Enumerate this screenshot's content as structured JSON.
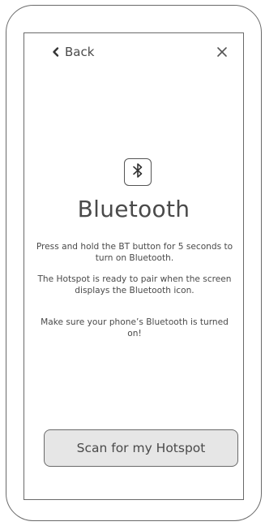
{
  "nav": {
    "back_label": "Back"
  },
  "content": {
    "title": "Bluetooth",
    "instruction_1": "Press and hold the BT button for 5 seconds to turn on Bluetooth.",
    "instruction_2": "The Hotspot is ready to pair when the screen displays the Bluetooth icon.",
    "instruction_3": "Make sure your phone’s Bluetooth is turned on!"
  },
  "actions": {
    "scan_label": "Scan for my Hotspot"
  },
  "icons": {
    "back": "chevron-left-icon",
    "close": "close-icon",
    "bluetooth": "bluetooth-icon"
  },
  "colors": {
    "outline": "#6a6a6a",
    "text": "#4a4a4a",
    "button_fill": "#e6e6e6"
  }
}
